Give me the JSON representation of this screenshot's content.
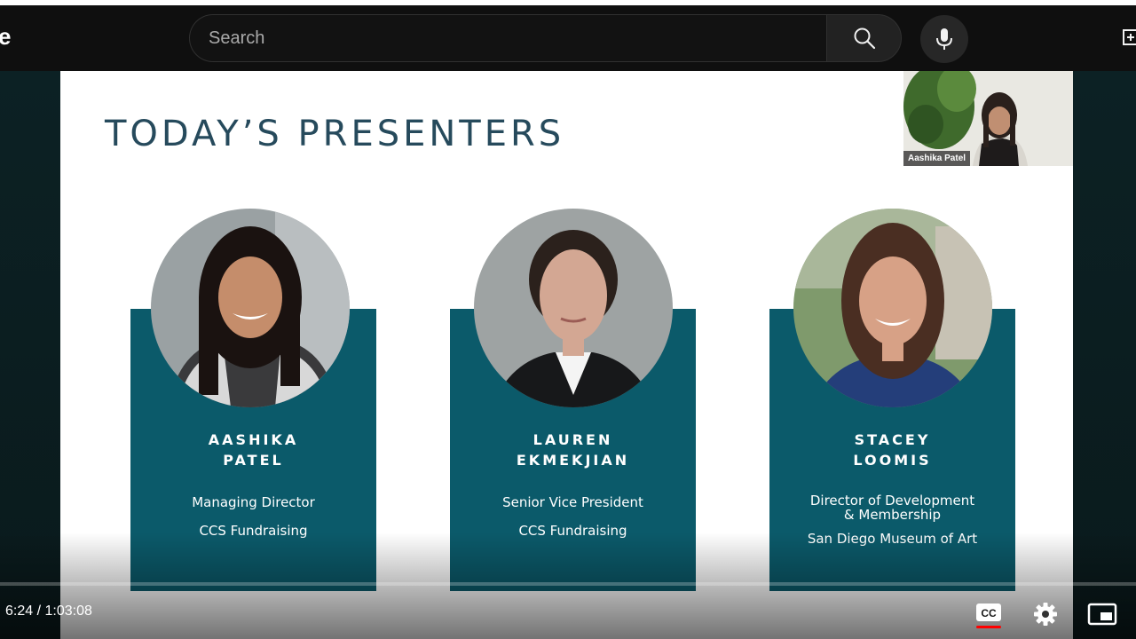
{
  "masthead": {
    "logo_fragment": "e",
    "search_placeholder": "Search"
  },
  "slide": {
    "title": "TODAY’S PRESENTERS",
    "presenters": [
      {
        "name_line1": "AASHIKA",
        "name_line2": "PATEL",
        "role": "Managing Director",
        "org": "CCS Fundraising"
      },
      {
        "name_line1": "LAUREN",
        "name_line2": "EKMEKJIAN",
        "role": "Senior Vice President",
        "org": "CCS Fundraising"
      },
      {
        "name_line1": "STACEY",
        "name_line2": "LOOMIS",
        "role_line1": "Director of Development",
        "role_line2": "& Membership",
        "org": "San Diego Museum of Art"
      }
    ],
    "pip_label": "Aashika Patel"
  },
  "player": {
    "time_display": "6:24 / 1:03:08",
    "icons": [
      "cc-icon",
      "gear-icon",
      "miniplayer-icon"
    ]
  },
  "colors": {
    "card_teal": "#0b5a6a",
    "title_navy": "#264a5c",
    "cc_underline": "#ff0000"
  }
}
